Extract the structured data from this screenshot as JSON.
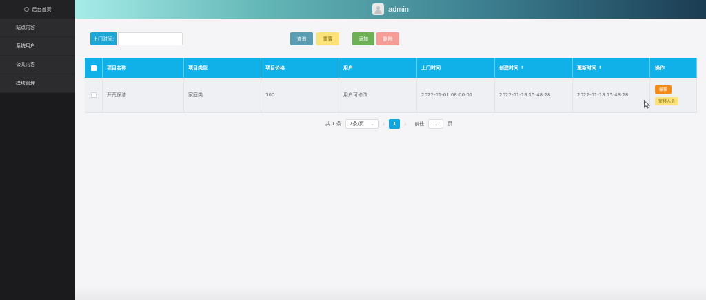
{
  "sidebar": {
    "brand": "后台首页",
    "items": [
      {
        "label": "站点内容"
      },
      {
        "label": "系统用户"
      },
      {
        "label": "公共内容"
      },
      {
        "label": "模块管理"
      }
    ]
  },
  "header": {
    "username": "admin"
  },
  "search": {
    "label": "上门时间:",
    "value": ""
  },
  "toolbar": {
    "query": "查询",
    "reset": "重置",
    "add": "添加",
    "delete": "删除"
  },
  "table": {
    "columns": [
      "项目名称",
      "项目类型",
      "项目价格",
      "用户",
      "上门时间",
      "创建时间",
      "更新时间",
      "操作"
    ],
    "rows": [
      {
        "name": "开荒保洁",
        "type": "家庭类",
        "price": "100",
        "user": "用户可修改",
        "visit_time": "2022-01-01 08:00:01",
        "created": "2022-01-18 15:48:28",
        "updated": "2022-01-18 15:48:28",
        "ops": [
          "编辑",
          "安排人员"
        ]
      }
    ]
  },
  "pagination": {
    "total": "共 1 条",
    "page_size": "7条/页",
    "current": "1",
    "goto_prefix": "前往",
    "goto_value": "1",
    "goto_suffix": "页"
  },
  "colors": {
    "header_accent": "#10b0e8",
    "query": "#5a9db2",
    "reset": "#fbe37a",
    "add": "#6eb155",
    "delete": "#f59c97",
    "edit": "#f28a17"
  }
}
